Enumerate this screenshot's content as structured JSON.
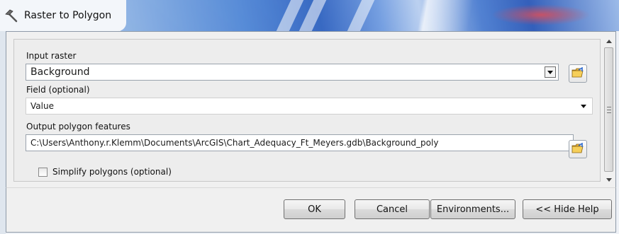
{
  "window": {
    "title": "Raster to Polygon",
    "icon": "hammer-icon"
  },
  "form": {
    "input_raster": {
      "label": "Input raster",
      "value": "Background",
      "browse_icon": "open-folder-icon"
    },
    "field": {
      "label": "Field (optional)",
      "value": "Value"
    },
    "output": {
      "label": "Output polygon features",
      "value": "C:\\Users\\Anthony.r.Klemm\\Documents\\ArcGIS\\Chart_Adequacy_Ft_Meyers.gdb\\Background_poly",
      "browse_icon": "open-folder-icon"
    },
    "simplify": {
      "label": "Simplify polygons (optional)",
      "checked": false
    }
  },
  "footer": {
    "ok": "OK",
    "cancel": "Cancel",
    "environments": "Environments...",
    "hide_help": "<< Hide Help"
  },
  "colors": {
    "title_banner": "#2f62c0",
    "frame_bg": "#f0f0f0",
    "field_bg": "#ffffff"
  }
}
